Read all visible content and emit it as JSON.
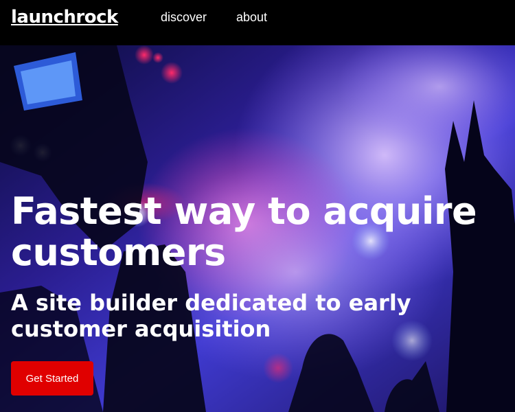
{
  "nav": {
    "logo": "launchrock",
    "links": [
      "discover",
      "about"
    ]
  },
  "hero": {
    "headline": "Fastest way to acquire customers",
    "subheadline": "A site builder dedicated to early customer acquisition",
    "cta_label": "Get Started"
  },
  "colors": {
    "nav_bg": "#000000",
    "cta": "#e00000",
    "text": "#ffffff"
  }
}
